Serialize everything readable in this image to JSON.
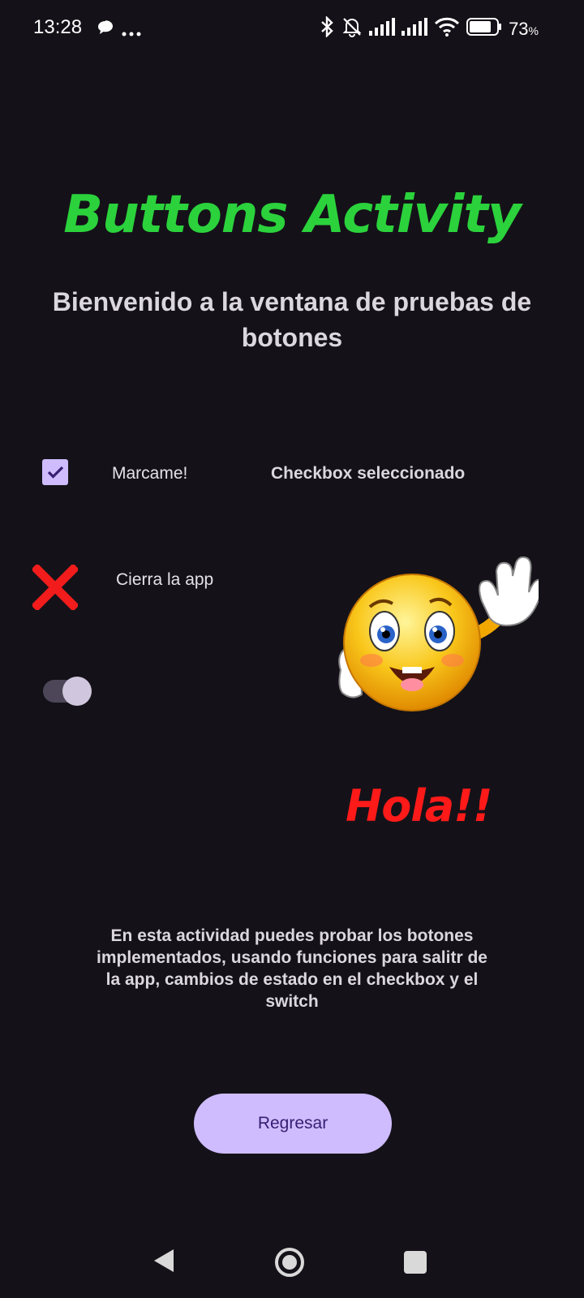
{
  "status_bar": {
    "time": "13:28",
    "battery_percent": "73",
    "battery_unit": "%",
    "icons": [
      "chat-bubble-icon",
      "more-dots-icon",
      "bluetooth-icon",
      "bell-muted-icon",
      "signal-icon",
      "signal-icon",
      "wifi-icon",
      "battery-icon"
    ]
  },
  "page": {
    "title": "Buttons Activity",
    "welcome": "Bienvenido a la ventana de pruebas de botones"
  },
  "checkbox": {
    "label": "Marcame!",
    "checked": true,
    "status": "Checkbox seleccionado"
  },
  "close_app": {
    "label": "Cierra la app",
    "icon": "red-x-icon"
  },
  "switch": {
    "checked": true
  },
  "image": {
    "icon": "waving-smiley-emoji",
    "caption": "Hola!!"
  },
  "description": "En esta actividad puedes probar los botones implementados, usando funciones para salitr de la app, cambios de estado en el checkbox y el switch",
  "back_button": {
    "label": "Regresar"
  },
  "nav": [
    "back-icon",
    "home-icon",
    "recents-icon"
  ],
  "colors": {
    "background": "#141218",
    "title": "#2bd23c",
    "accent": "#cfbcff",
    "hola": "#ff1a1a"
  }
}
